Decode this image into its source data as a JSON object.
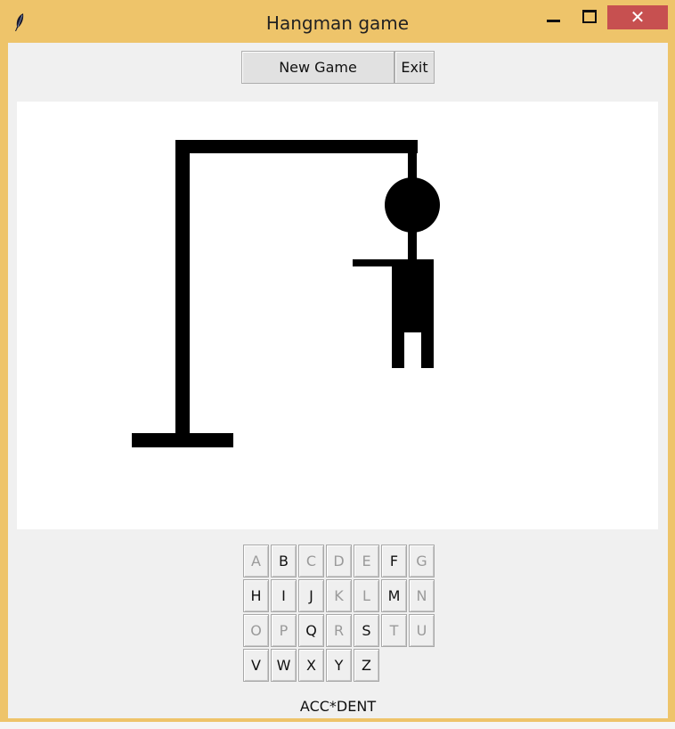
{
  "window": {
    "title": "Hangman game",
    "close_glyph": "✕",
    "frame_color": "#eec46a",
    "close_color": "#c75050"
  },
  "toolbar": {
    "new_game_label": "New Game",
    "exit_label": "Exit"
  },
  "keyboard": {
    "rows": [
      [
        {
          "l": "A",
          "used": true
        },
        {
          "l": "B",
          "used": false
        },
        {
          "l": "C",
          "used": true
        },
        {
          "l": "D",
          "used": true
        },
        {
          "l": "E",
          "used": true
        },
        {
          "l": "F",
          "used": false
        },
        {
          "l": "G",
          "used": true
        }
      ],
      [
        {
          "l": "H",
          "used": false
        },
        {
          "l": "I",
          "used": false
        },
        {
          "l": "J",
          "used": false
        },
        {
          "l": "K",
          "used": true
        },
        {
          "l": "L",
          "used": true
        },
        {
          "l": "M",
          "used": false
        },
        {
          "l": "N",
          "used": true
        }
      ],
      [
        {
          "l": "O",
          "used": true
        },
        {
          "l": "P",
          "used": true
        },
        {
          "l": "Q",
          "used": false
        },
        {
          "l": "R",
          "used": true
        },
        {
          "l": "S",
          "used": false
        },
        {
          "l": "T",
          "used": true
        },
        {
          "l": "U",
          "used": true
        }
      ],
      [
        {
          "l": "V",
          "used": false
        },
        {
          "l": "W",
          "used": false
        },
        {
          "l": "X",
          "used": false
        },
        {
          "l": "Y",
          "used": false
        },
        {
          "l": "Z",
          "used": false
        }
      ]
    ]
  },
  "status": {
    "word": "ACC*DENT"
  }
}
